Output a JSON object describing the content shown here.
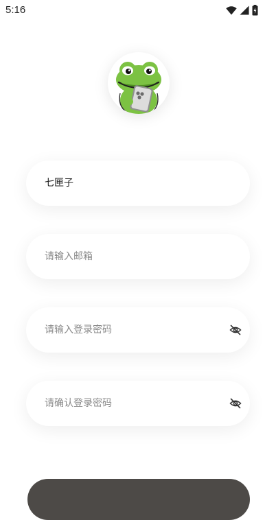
{
  "status_bar": {
    "time": "5:16",
    "icons": [
      "wifi-icon",
      "signal-icon",
      "battery-icon"
    ]
  },
  "avatar": {
    "icon": "frog-mascot"
  },
  "form": {
    "nickname": {
      "value": "七匣子"
    },
    "email": {
      "placeholder": "请输入邮箱"
    },
    "password": {
      "placeholder": "请输入登录密码",
      "toggle_icon": "eye-off-icon"
    },
    "confirm_password": {
      "placeholder": "请确认登录密码",
      "toggle_icon": "eye-off-icon"
    }
  },
  "submit": {
    "label": ""
  },
  "colors": {
    "button_bg": "#4d4a47",
    "placeholder": "#8a8a8a",
    "text": "#222222",
    "frog_green": "#7cc243"
  }
}
